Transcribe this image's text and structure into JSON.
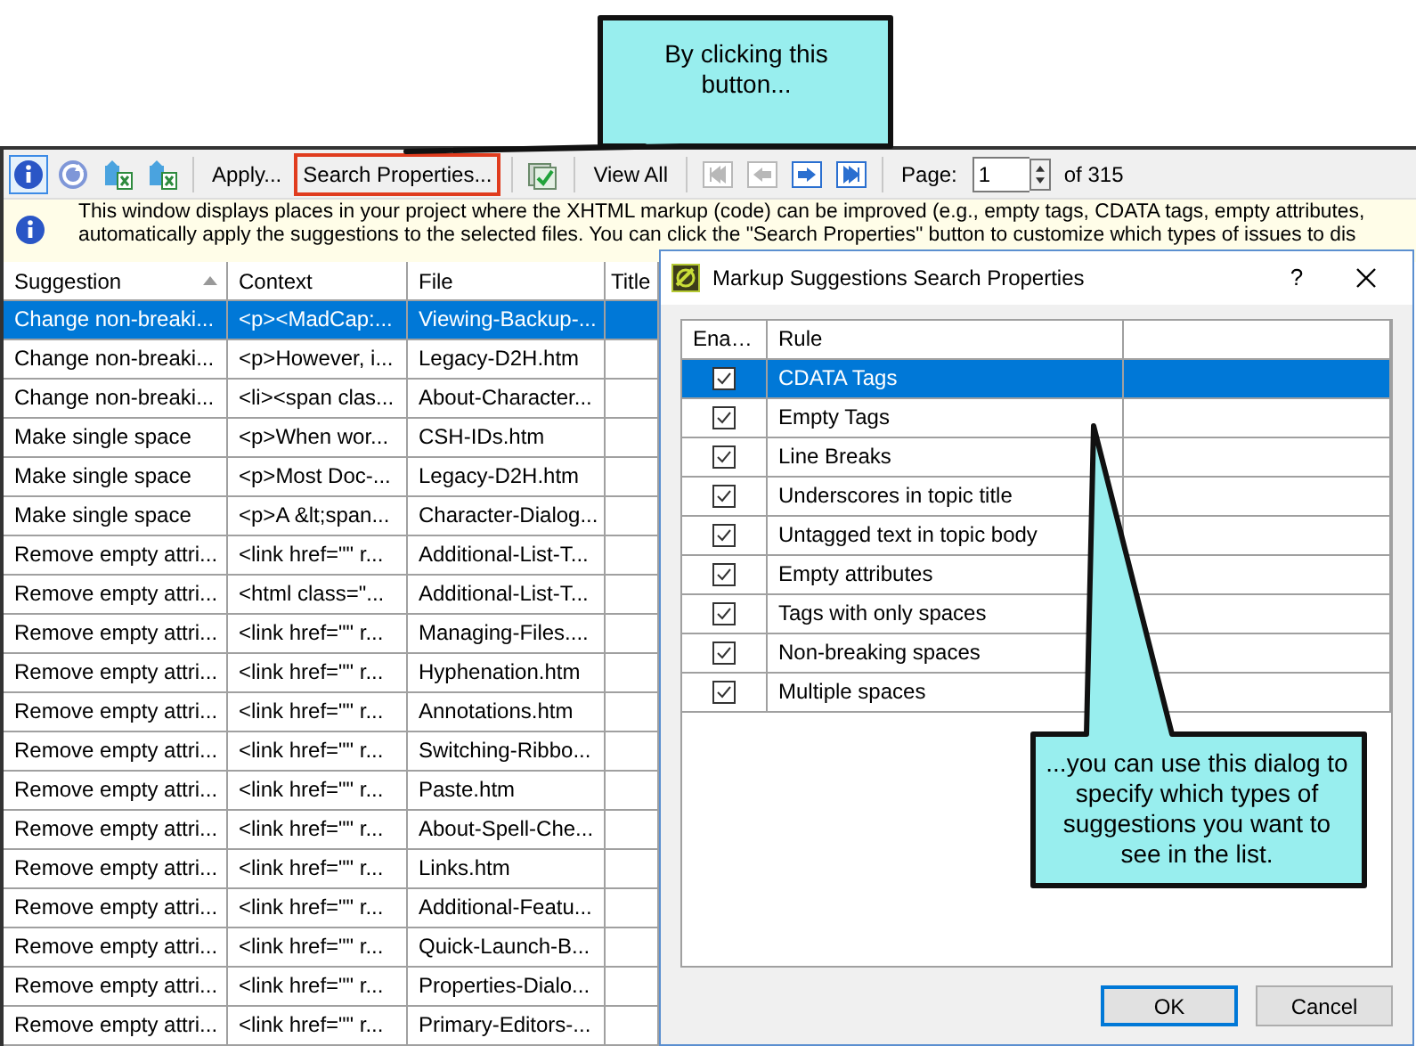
{
  "toolbar": [
    {
      "kind": "info",
      "pressed": true
    },
    {
      "kind": "refresh",
      "pressed": false
    },
    {
      "kind": "export",
      "pressed": false
    },
    {
      "kind": "export",
      "pressed": false
    },
    {
      "kind": "separator"
    },
    {
      "kind": "button",
      "label": "Apply...",
      "highlighted": false
    },
    {
      "kind": "button",
      "label": "Search Properties...",
      "highlighted": true
    },
    {
      "kind": "separator"
    },
    {
      "kind": "check",
      "pressed": false
    },
    {
      "kind": "separator"
    },
    {
      "kind": "button",
      "label": "View All",
      "highlighted": false
    },
    {
      "kind": "separator"
    },
    {
      "kind": "first",
      "disabled": true
    },
    {
      "kind": "prev",
      "disabled": true
    },
    {
      "kind": "next",
      "disabled": false
    },
    {
      "kind": "last",
      "disabled": false
    },
    {
      "kind": "separator"
    },
    {
      "kind": "page",
      "label": "Page:",
      "value": "1",
      "total": "of 315"
    }
  ],
  "info_bar": {
    "lines": [
      "This window displays places in your project where the XHTML markup (code) can be improved (e.g., empty tags, CDATA tags, empty attributes,",
      "automatically apply the suggestions to the selected files. You can click the \"Search Properties\" button to customize which types of issues to dis"
    ]
  },
  "table": {
    "columns": [
      {
        "label": "Suggestion",
        "sorted": true
      },
      {
        "label": "Context",
        "sorted": false
      },
      {
        "label": "File",
        "sorted": false
      },
      {
        "label": "Title",
        "sorted": false
      }
    ],
    "rows": [
      {
        "suggestion": "Change non-breaki...",
        "context": "<p><MadCap:...",
        "file": "Viewing-Backup-...",
        "selected": true
      },
      {
        "suggestion": "Change non-breaki...",
        "context": "<p>However, i...",
        "file": "Legacy-D2H.htm",
        "selected": false
      },
      {
        "suggestion": "Change non-breaki...",
        "context": "<li><span clas...",
        "file": "About-Character...",
        "selected": false
      },
      {
        "suggestion": "Make single space",
        "context": "<p>When wor...",
        "file": "CSH-IDs.htm",
        "selected": false
      },
      {
        "suggestion": "Make single space",
        "context": "<p>Most Doc-...",
        "file": "Legacy-D2H.htm",
        "selected": false
      },
      {
        "suggestion": "Make single space",
        "context": "<p>A &lt;span...",
        "file": "Character-Dialog...",
        "selected": false
      },
      {
        "suggestion": "Remove empty attri...",
        "context": "<link href=\"\" r...",
        "file": "Additional-List-T...",
        "selected": false
      },
      {
        "suggestion": "Remove empty attri...",
        "context": "<html  class=\"...",
        "file": "Additional-List-T...",
        "selected": false
      },
      {
        "suggestion": "Remove empty attri...",
        "context": "<link href=\"\" r...",
        "file": "Managing-Files....",
        "selected": false
      },
      {
        "suggestion": "Remove empty attri...",
        "context": "<link href=\"\" r...",
        "file": "Hyphenation.htm",
        "selected": false
      },
      {
        "suggestion": "Remove empty attri...",
        "context": "<link href=\"\" r...",
        "file": "Annotations.htm",
        "selected": false
      },
      {
        "suggestion": "Remove empty attri...",
        "context": "<link href=\"\" r...",
        "file": "Switching-Ribbo...",
        "selected": false
      },
      {
        "suggestion": "Remove empty attri...",
        "context": "<link href=\"\" r...",
        "file": "Paste.htm",
        "selected": false
      },
      {
        "suggestion": "Remove empty attri...",
        "context": "<link href=\"\" r...",
        "file": "About-Spell-Che...",
        "selected": false
      },
      {
        "suggestion": "Remove empty attri...",
        "context": "<link href=\"\" r...",
        "file": "Links.htm",
        "selected": false
      },
      {
        "suggestion": "Remove empty attri...",
        "context": "<link href=\"\" r...",
        "file": "Additional-Featu...",
        "selected": false
      },
      {
        "suggestion": "Remove empty attri...",
        "context": "<link href=\"\" r...",
        "file": "Quick-Launch-B...",
        "selected": false
      },
      {
        "suggestion": "Remove empty attri...",
        "context": "<link href=\"\" r...",
        "file": "Properties-Dialo...",
        "selected": false
      },
      {
        "suggestion": "Remove empty attri...",
        "context": "<link href=\"\" r...",
        "file": "Primary-Editors-...",
        "selected": false
      }
    ]
  },
  "dialog": {
    "title": "Markup Suggestions Search Properties",
    "help": "?",
    "columns": [
      "Ena…",
      "Rule"
    ],
    "rules": [
      {
        "name": "CDATA Tags",
        "enabled": true,
        "selected": true
      },
      {
        "name": "Empty Tags",
        "enabled": true,
        "selected": false
      },
      {
        "name": "Line Breaks",
        "enabled": true,
        "selected": false
      },
      {
        "name": "Underscores in topic title",
        "enabled": true,
        "selected": false
      },
      {
        "name": "Untagged text in topic body",
        "enabled": true,
        "selected": false
      },
      {
        "name": "Empty attributes",
        "enabled": true,
        "selected": false
      },
      {
        "name": "Tags with only spaces",
        "enabled": true,
        "selected": false
      },
      {
        "name": "Non-breaking spaces",
        "enabled": true,
        "selected": false
      },
      {
        "name": "Multiple spaces",
        "enabled": true,
        "selected": false
      }
    ],
    "buttons": [
      {
        "label": "OK",
        "default": true
      },
      {
        "label": "Cancel",
        "default": false
      }
    ]
  },
  "callouts": [
    {
      "text": "By clicking this button..."
    },
    {
      "text": "...you can use this dialog to specify which types of suggestions you want to see in the list."
    }
  ]
}
